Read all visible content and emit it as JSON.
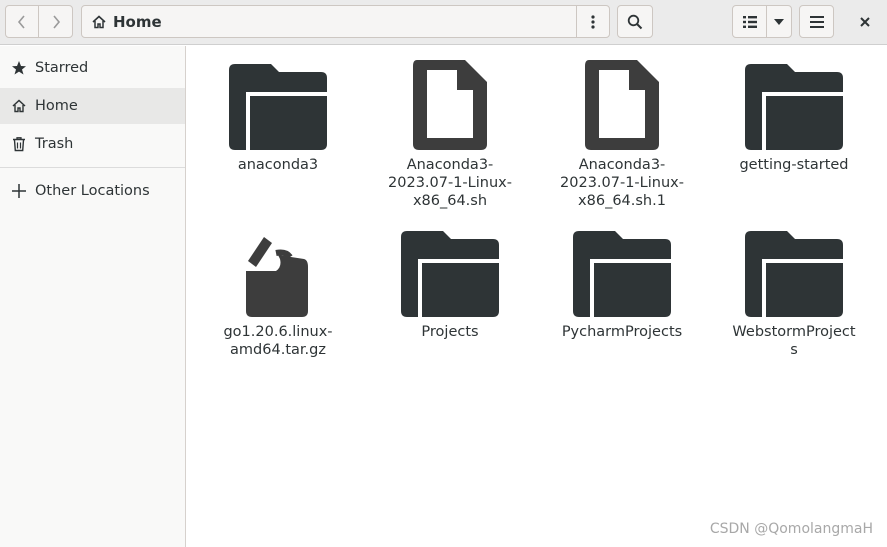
{
  "window": {
    "location": "Home",
    "close_glyph": "✕"
  },
  "icons": {
    "back": "chevron-left-icon",
    "forward": "chevron-right-icon",
    "home": "home-icon",
    "path_menu": "vertical-dots-icon",
    "search": "search-icon",
    "list_view": "list-view-icon",
    "view_options": "triangle-down-icon",
    "main_menu": "hamburger-icon",
    "close": "close-icon"
  },
  "sidebar": {
    "items": [
      {
        "label": "Starred",
        "icon": "star-icon"
      },
      {
        "label": "Home",
        "icon": "home-icon",
        "active": true
      },
      {
        "label": "Trash",
        "icon": "trash-icon"
      },
      {
        "label": "Other Locations",
        "icon": "plus-icon"
      }
    ]
  },
  "files": [
    {
      "name": "anaconda3",
      "type": "folder"
    },
    {
      "name": "Anaconda3-2023.07-1-Linux-x86_64.sh",
      "type": "document"
    },
    {
      "name": "Anaconda3-2023.07-1-Linux-x86_64.sh.1",
      "type": "document"
    },
    {
      "name": "getting-started",
      "type": "folder"
    },
    {
      "name": "go1.20.6.linux-amd64.tar.gz",
      "type": "archive"
    },
    {
      "name": "Projects",
      "type": "folder"
    },
    {
      "name": "PycharmProjects",
      "type": "folder"
    },
    {
      "name": "WebstormProjects",
      "type": "folder"
    }
  ],
  "labels": [
    [
      "anaconda3"
    ],
    [
      "Anaconda3-",
      "2023.07-1-Linux-",
      "x86_64.sh"
    ],
    [
      "Anaconda3-",
      "2023.07-1-Linux-",
      "x86_64.sh.1"
    ],
    [
      "getting-started"
    ],
    [
      "go1.20.6.linux-",
      "amd64.tar.gz"
    ],
    [
      "Projects"
    ],
    [
      "PycharmProjects"
    ],
    [
      "WebstormProjects"
    ]
  ],
  "watermark": "CSDN @QomolangmaH",
  "colors": {
    "icon_dark": "#2e3436",
    "doc_gray": "#3d3d3d",
    "header_bg": "#ebebeb",
    "sidebar_active": "#e8e8e7"
  }
}
